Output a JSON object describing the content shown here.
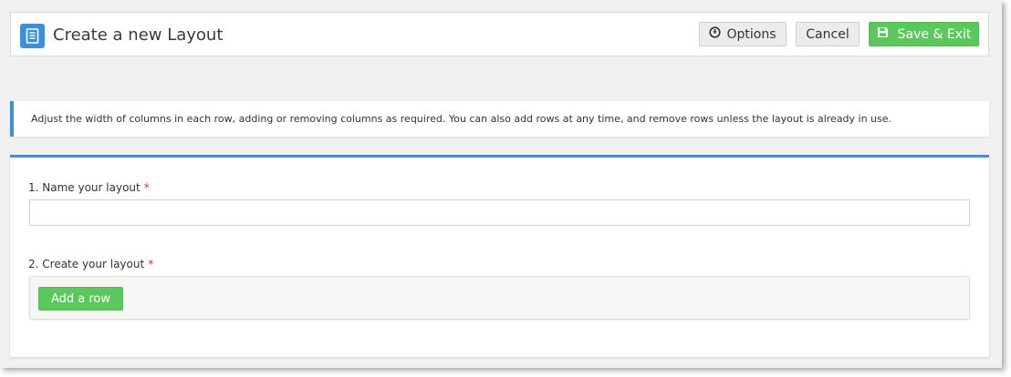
{
  "header": {
    "title": "Create a new Layout",
    "icon": "document-icon",
    "buttons": {
      "options_label": "Options",
      "options_icon": "arrow-down-circle-icon",
      "cancel_label": "Cancel",
      "save_label": "Save & Exit",
      "save_icon": "floppy-disk-icon"
    }
  },
  "info": {
    "text": "Adjust the width of columns in each row, adding or removing columns as required. You can also add rows at any time, and remove rows unless the layout is already in use."
  },
  "form": {
    "name_label": "1. Name your layout",
    "name_required": "*",
    "name_value": "",
    "name_placeholder": "",
    "create_label": "2. Create your layout",
    "create_required": "*",
    "add_row_label": "Add a row"
  },
  "colors": {
    "accent_blue": "#3d8fd6",
    "success_green": "#5cc75c",
    "required_red": "#d9302c"
  }
}
